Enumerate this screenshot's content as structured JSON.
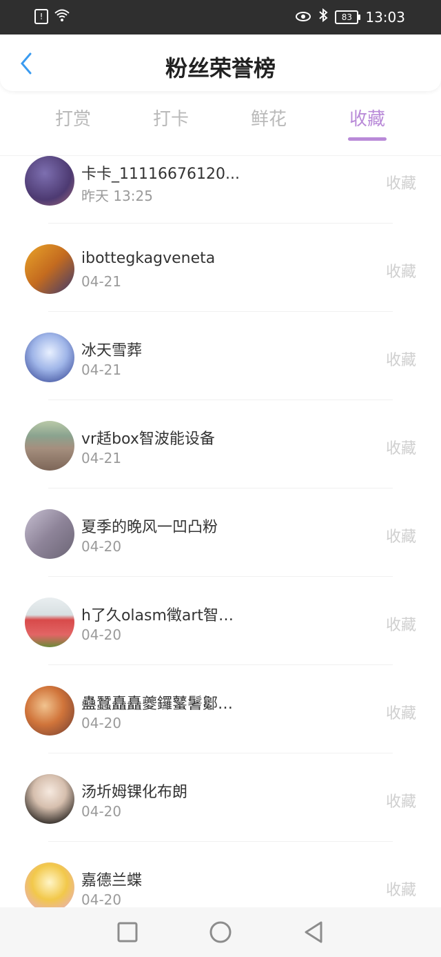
{
  "status_bar": {
    "time": "13:03",
    "battery": "83"
  },
  "header": {
    "title": "粉丝荣誉榜"
  },
  "tabs": [
    {
      "label": "打赏"
    },
    {
      "label": "打卡"
    },
    {
      "label": "鲜花"
    },
    {
      "label": "收藏",
      "active": true
    }
  ],
  "list": [
    {
      "name": "卡卡_11116676120...",
      "time": "昨天 13:25",
      "action": "收藏"
    },
    {
      "name": "ibottegkagveneta",
      "time": "04-21",
      "action": "收藏"
    },
    {
      "name": "冰天雪葬",
      "time": "04-21",
      "action": "收藏"
    },
    {
      "name": "vr趏box智波能设备",
      "time": "04-21",
      "action": "收藏"
    },
    {
      "name": "夏季的晚风一凹凸粉",
      "time": "04-20",
      "action": "收藏"
    },
    {
      "name": "h了久olasm徵art智…",
      "time": "04-20",
      "action": "收藏"
    },
    {
      "name": "蠱蠶矗矗夔鑼鼜鬐酁…",
      "time": "04-20",
      "action": "收藏"
    },
    {
      "name": "汤圻姆锞化布朗",
      "time": "04-20",
      "action": "收藏"
    },
    {
      "name": "嘉德兰蝶",
      "time": "04-20",
      "action": "收藏"
    }
  ],
  "colors": {
    "accent": "#b98ad8",
    "back": "#3a9bf0"
  }
}
